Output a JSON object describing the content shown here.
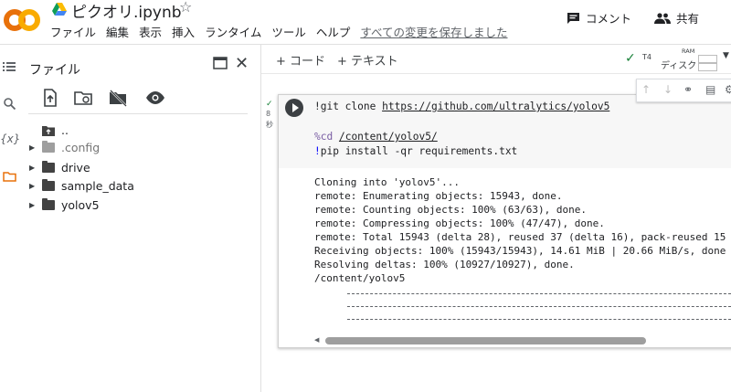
{
  "notebook": {
    "title": "ピクオリ.ipynb"
  },
  "menu": {
    "items": [
      "ファイル",
      "編集",
      "表示",
      "挿入",
      "ランタイム",
      "ツール",
      "ヘルプ"
    ],
    "save_status": "すべての変更を保存しました"
  },
  "header": {
    "comment_label": "コメント",
    "share_label": "共有"
  },
  "files_panel": {
    "title": "ファイル",
    "tree": [
      {
        "label": "..",
        "kind": "up",
        "dim": false
      },
      {
        "label": ".config",
        "kind": "folder",
        "dim": true
      },
      {
        "label": "drive",
        "kind": "folder",
        "dim": false
      },
      {
        "label": "sample_data",
        "kind": "folder",
        "dim": false
      },
      {
        "label": "yolov5",
        "kind": "folder",
        "dim": false
      }
    ]
  },
  "toolbar": {
    "add_code": "+ コード",
    "add_text": "+ テキスト",
    "runtime_gpu": "T4",
    "ram_label": "RAM",
    "disk_label": "ディスク"
  },
  "rail": {
    "variables_label": "{x}"
  },
  "cell": {
    "exec_time": "8",
    "exec_unit": "秒",
    "code": {
      "line1_cmd": "!git clone ",
      "line1_url": "https://github.com/ultralytics/yolov5",
      "line2_magic": "%cd",
      "line2_path": "/content/yolov5/",
      "line3_bang": "!",
      "line3_cmd": "pip install -qr requirements.txt"
    },
    "output": [
      "Cloning into 'yolov5'...",
      "remote: Enumerating objects: 15943, done.",
      "remote: Counting objects: 100% (63/63), done.",
      "remote: Compressing objects: 100% (47/47), done.",
      "remote: Total 15943 (delta 28), reused 37 (delta 16), pack-reused 15",
      "Receiving objects: 100% (15943/15943), 14.61 MiB | 20.66 MiB/s, done",
      "Resolving deltas: 100% (10927/10927), done.",
      "/content/yolov5"
    ]
  },
  "colors": {
    "accent": "#f9ab00",
    "brand_orange": "#e8710a",
    "ok_green": "#188038"
  }
}
